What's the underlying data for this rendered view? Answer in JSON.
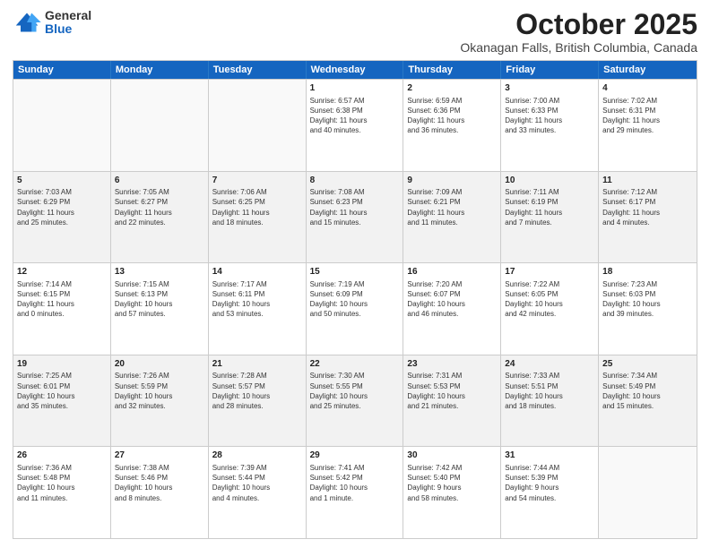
{
  "logo": {
    "general": "General",
    "blue": "Blue"
  },
  "title": "October 2025",
  "subtitle": "Okanagan Falls, British Columbia, Canada",
  "weekdays": [
    "Sunday",
    "Monday",
    "Tuesday",
    "Wednesday",
    "Thursday",
    "Friday",
    "Saturday"
  ],
  "rows": [
    [
      {
        "day": "",
        "info": ""
      },
      {
        "day": "",
        "info": ""
      },
      {
        "day": "",
        "info": ""
      },
      {
        "day": "1",
        "info": "Sunrise: 6:57 AM\nSunset: 6:38 PM\nDaylight: 11 hours\nand 40 minutes."
      },
      {
        "day": "2",
        "info": "Sunrise: 6:59 AM\nSunset: 6:36 PM\nDaylight: 11 hours\nand 36 minutes."
      },
      {
        "day": "3",
        "info": "Sunrise: 7:00 AM\nSunset: 6:33 PM\nDaylight: 11 hours\nand 33 minutes."
      },
      {
        "day": "4",
        "info": "Sunrise: 7:02 AM\nSunset: 6:31 PM\nDaylight: 11 hours\nand 29 minutes."
      }
    ],
    [
      {
        "day": "5",
        "info": "Sunrise: 7:03 AM\nSunset: 6:29 PM\nDaylight: 11 hours\nand 25 minutes."
      },
      {
        "day": "6",
        "info": "Sunrise: 7:05 AM\nSunset: 6:27 PM\nDaylight: 11 hours\nand 22 minutes."
      },
      {
        "day": "7",
        "info": "Sunrise: 7:06 AM\nSunset: 6:25 PM\nDaylight: 11 hours\nand 18 minutes."
      },
      {
        "day": "8",
        "info": "Sunrise: 7:08 AM\nSunset: 6:23 PM\nDaylight: 11 hours\nand 15 minutes."
      },
      {
        "day": "9",
        "info": "Sunrise: 7:09 AM\nSunset: 6:21 PM\nDaylight: 11 hours\nand 11 minutes."
      },
      {
        "day": "10",
        "info": "Sunrise: 7:11 AM\nSunset: 6:19 PM\nDaylight: 11 hours\nand 7 minutes."
      },
      {
        "day": "11",
        "info": "Sunrise: 7:12 AM\nSunset: 6:17 PM\nDaylight: 11 hours\nand 4 minutes."
      }
    ],
    [
      {
        "day": "12",
        "info": "Sunrise: 7:14 AM\nSunset: 6:15 PM\nDaylight: 11 hours\nand 0 minutes."
      },
      {
        "day": "13",
        "info": "Sunrise: 7:15 AM\nSunset: 6:13 PM\nDaylight: 10 hours\nand 57 minutes."
      },
      {
        "day": "14",
        "info": "Sunrise: 7:17 AM\nSunset: 6:11 PM\nDaylight: 10 hours\nand 53 minutes."
      },
      {
        "day": "15",
        "info": "Sunrise: 7:19 AM\nSunset: 6:09 PM\nDaylight: 10 hours\nand 50 minutes."
      },
      {
        "day": "16",
        "info": "Sunrise: 7:20 AM\nSunset: 6:07 PM\nDaylight: 10 hours\nand 46 minutes."
      },
      {
        "day": "17",
        "info": "Sunrise: 7:22 AM\nSunset: 6:05 PM\nDaylight: 10 hours\nand 42 minutes."
      },
      {
        "day": "18",
        "info": "Sunrise: 7:23 AM\nSunset: 6:03 PM\nDaylight: 10 hours\nand 39 minutes."
      }
    ],
    [
      {
        "day": "19",
        "info": "Sunrise: 7:25 AM\nSunset: 6:01 PM\nDaylight: 10 hours\nand 35 minutes."
      },
      {
        "day": "20",
        "info": "Sunrise: 7:26 AM\nSunset: 5:59 PM\nDaylight: 10 hours\nand 32 minutes."
      },
      {
        "day": "21",
        "info": "Sunrise: 7:28 AM\nSunset: 5:57 PM\nDaylight: 10 hours\nand 28 minutes."
      },
      {
        "day": "22",
        "info": "Sunrise: 7:30 AM\nSunset: 5:55 PM\nDaylight: 10 hours\nand 25 minutes."
      },
      {
        "day": "23",
        "info": "Sunrise: 7:31 AM\nSunset: 5:53 PM\nDaylight: 10 hours\nand 21 minutes."
      },
      {
        "day": "24",
        "info": "Sunrise: 7:33 AM\nSunset: 5:51 PM\nDaylight: 10 hours\nand 18 minutes."
      },
      {
        "day": "25",
        "info": "Sunrise: 7:34 AM\nSunset: 5:49 PM\nDaylight: 10 hours\nand 15 minutes."
      }
    ],
    [
      {
        "day": "26",
        "info": "Sunrise: 7:36 AM\nSunset: 5:48 PM\nDaylight: 10 hours\nand 11 minutes."
      },
      {
        "day": "27",
        "info": "Sunrise: 7:38 AM\nSunset: 5:46 PM\nDaylight: 10 hours\nand 8 minutes."
      },
      {
        "day": "28",
        "info": "Sunrise: 7:39 AM\nSunset: 5:44 PM\nDaylight: 10 hours\nand 4 minutes."
      },
      {
        "day": "29",
        "info": "Sunrise: 7:41 AM\nSunset: 5:42 PM\nDaylight: 10 hours\nand 1 minute."
      },
      {
        "day": "30",
        "info": "Sunrise: 7:42 AM\nSunset: 5:40 PM\nDaylight: 9 hours\nand 58 minutes."
      },
      {
        "day": "31",
        "info": "Sunrise: 7:44 AM\nSunset: 5:39 PM\nDaylight: 9 hours\nand 54 minutes."
      },
      {
        "day": "",
        "info": ""
      }
    ]
  ]
}
